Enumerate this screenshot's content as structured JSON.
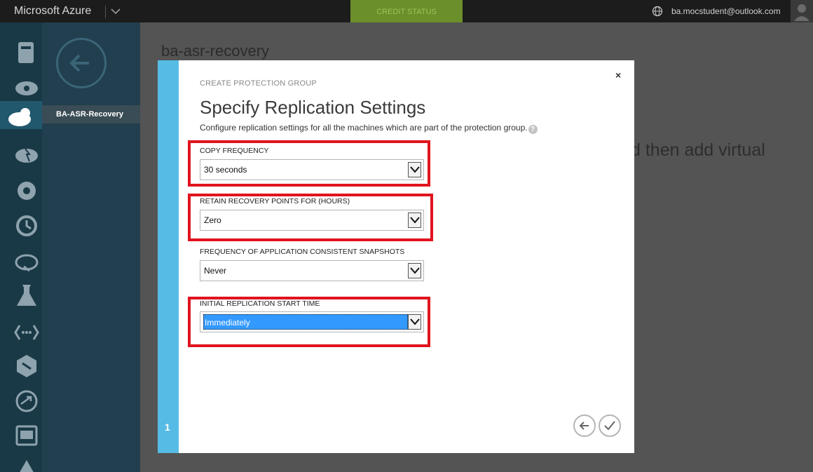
{
  "topbar": {
    "brand": "Microsoft Azure",
    "credit_status": "CREDIT STATUS",
    "account": "ba.mocstudent@outlook.com",
    "icons": [
      "chevron-down-icon",
      "globe-icon",
      "user-avatar-icon"
    ]
  },
  "rail": {
    "icons": [
      "storage-icon",
      "cloud-services-icon",
      "recovery-services-icon",
      "hdinsight-icon",
      "automation-icon",
      "scheduler-icon",
      "cloud-sync-icon",
      "machine-learning-icon",
      "api-management-icon",
      "biztalk-icon",
      "networks-icon",
      "traffic-manager-icon",
      "alert-icon"
    ]
  },
  "subnav": {
    "back_icon": "arrow-left-circle-icon",
    "item": "BA-ASR-Recovery"
  },
  "main": {
    "title": "ba-asr-recovery",
    "hint": "d then add virtual"
  },
  "dialog": {
    "step": "1",
    "subtitle": "CREATE PROTECTION GROUP",
    "title": "Specify Replication Settings",
    "description": "Configure replication settings for all the machines which are part of the protection group.",
    "help_icon": "?",
    "fields": [
      {
        "label": "COPY FREQUENCY",
        "value": "30 seconds",
        "highlighted_box": true
      },
      {
        "label": "RETAIN RECOVERY POINTS FOR (HOURS)",
        "value": "Zero",
        "highlighted_box": true
      },
      {
        "label": "FREQUENCY OF APPLICATION CONSISTENT SNAPSHOTS",
        "value": "Never",
        "highlighted_box": false
      },
      {
        "label": "INITIAL REPLICATION START TIME",
        "value": "Immediately",
        "highlighted_box": true,
        "selected": true
      }
    ],
    "back_button_icon": "arrow-left-icon",
    "confirm_button_icon": "checkmark-icon",
    "close_icon": "×"
  },
  "colors": {
    "accent_blue": "#56bce5",
    "highlight_red": "#e0141e",
    "selection_blue": "#3399ff",
    "credit_green": "#6b8f2a"
  }
}
